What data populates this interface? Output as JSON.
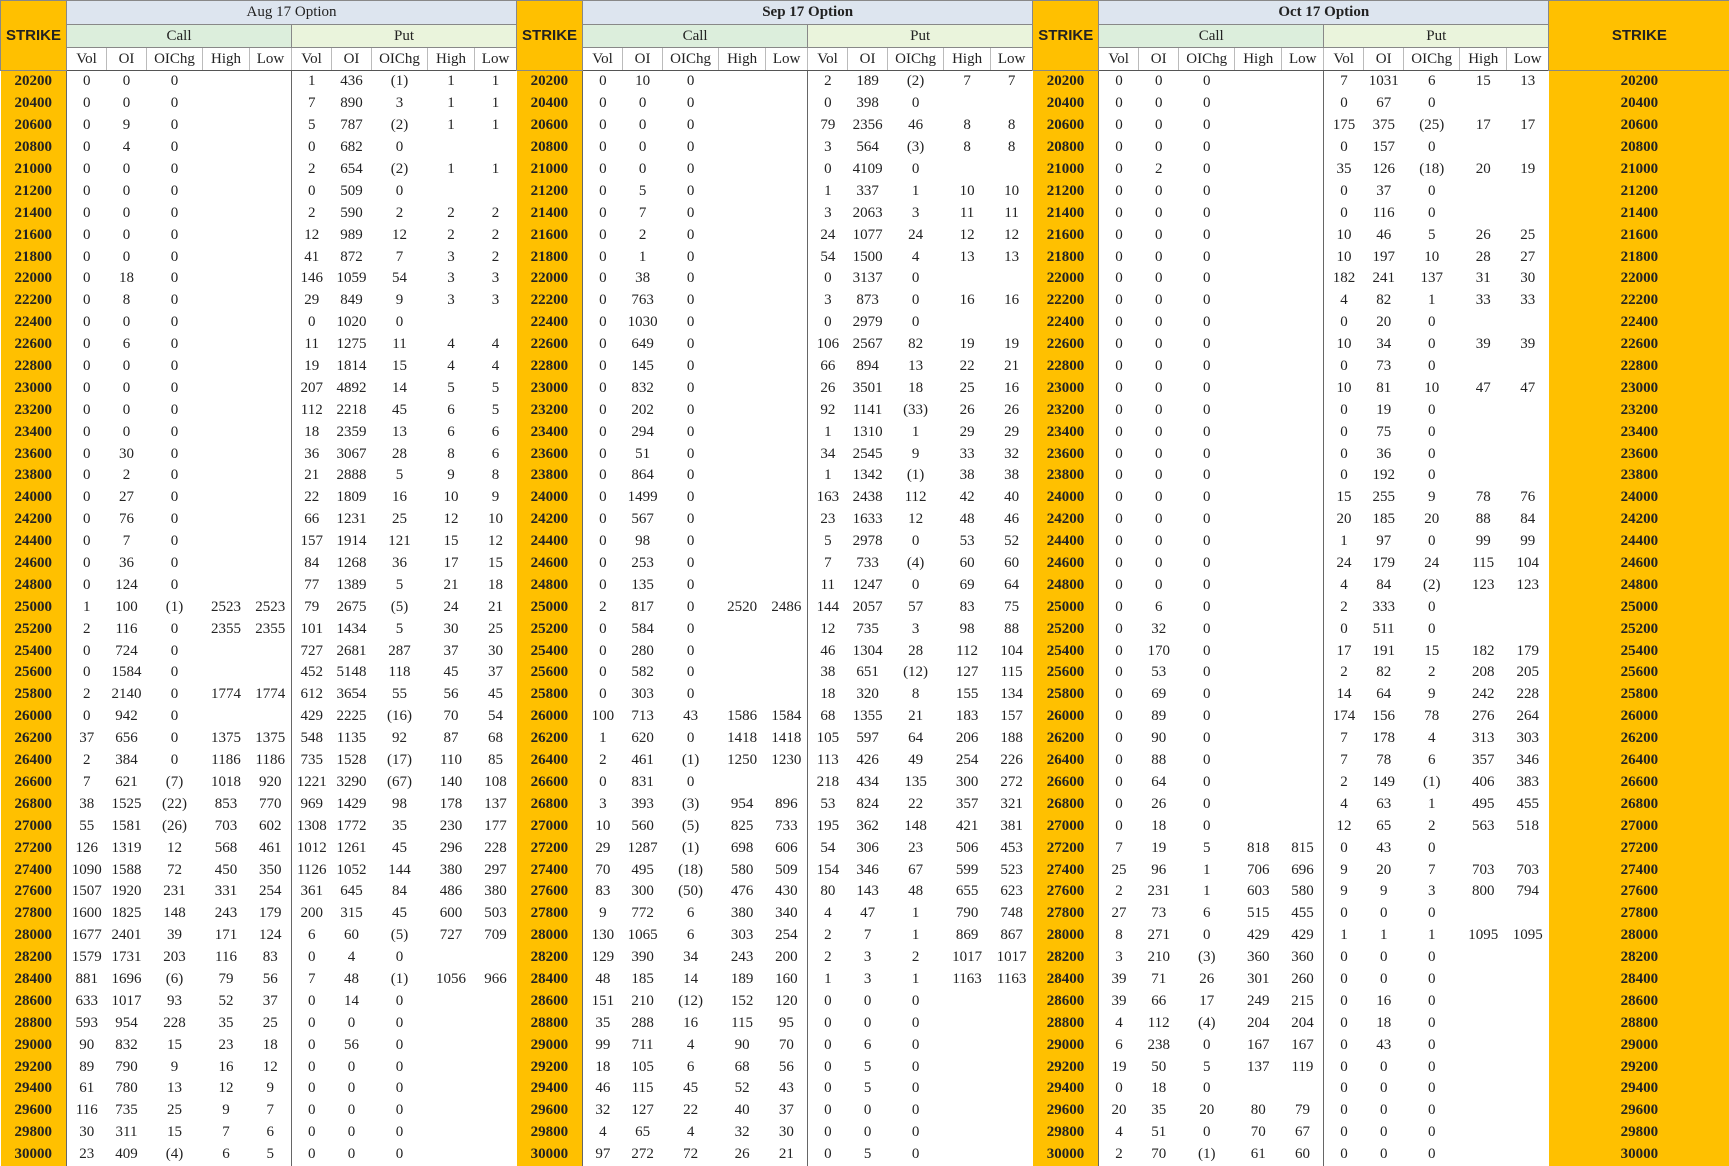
{
  "strike_label": "STRIKE",
  "columns": [
    "Vol",
    "OI",
    "OIChg",
    "High",
    "Low"
  ],
  "call_label": "Call",
  "put_label": "Put",
  "months": [
    "Aug 17 Option",
    "Sep 17 Option",
    "Oct 17 Option"
  ],
  "rows": [
    [
      "20200",
      "0",
      "0",
      "0",
      "",
      "",
      "1",
      "436",
      "(1)",
      "1",
      "1",
      "0",
      "10",
      "0",
      "",
      "",
      "2",
      "189",
      "(2)",
      "7",
      "7",
      "0",
      "0",
      "0",
      "",
      "",
      "7",
      "1031",
      "6",
      "15",
      "13"
    ],
    [
      "20400",
      "0",
      "0",
      "0",
      "",
      "",
      "7",
      "890",
      "3",
      "1",
      "1",
      "0",
      "0",
      "0",
      "",
      "",
      "0",
      "398",
      "0",
      "",
      "",
      "0",
      "0",
      "0",
      "",
      "",
      "0",
      "67",
      "0",
      "",
      ""
    ],
    [
      "20600",
      "0",
      "9",
      "0",
      "",
      "",
      "5",
      "787",
      "(2)",
      "1",
      "1",
      "0",
      "0",
      "0",
      "",
      "",
      "79",
      "2356",
      "46",
      "8",
      "8",
      "0",
      "0",
      "0",
      "",
      "",
      "175",
      "375",
      "(25)",
      "17",
      "17"
    ],
    [
      "20800",
      "0",
      "4",
      "0",
      "",
      "",
      "0",
      "682",
      "0",
      "",
      "",
      "0",
      "0",
      "0",
      "",
      "",
      "3",
      "564",
      "(3)",
      "8",
      "8",
      "0",
      "0",
      "0",
      "",
      "",
      "0",
      "157",
      "0",
      "",
      ""
    ],
    [
      "21000",
      "0",
      "0",
      "0",
      "",
      "",
      "2",
      "654",
      "(2)",
      "1",
      "1",
      "0",
      "0",
      "0",
      "",
      "",
      "0",
      "4109",
      "0",
      "",
      "",
      "0",
      "2",
      "0",
      "",
      "",
      "35",
      "126",
      "(18)",
      "20",
      "19"
    ],
    [
      "21200",
      "0",
      "0",
      "0",
      "",
      "",
      "0",
      "509",
      "0",
      "",
      "",
      "0",
      "5",
      "0",
      "",
      "",
      "1",
      "337",
      "1",
      "10",
      "10",
      "0",
      "0",
      "0",
      "",
      "",
      "0",
      "37",
      "0",
      "",
      ""
    ],
    [
      "21400",
      "0",
      "0",
      "0",
      "",
      "",
      "2",
      "590",
      "2",
      "2",
      "2",
      "0",
      "7",
      "0",
      "",
      "",
      "3",
      "2063",
      "3",
      "11",
      "11",
      "0",
      "0",
      "0",
      "",
      "",
      "0",
      "116",
      "0",
      "",
      ""
    ],
    [
      "21600",
      "0",
      "0",
      "0",
      "",
      "",
      "12",
      "989",
      "12",
      "2",
      "2",
      "0",
      "2",
      "0",
      "",
      "",
      "24",
      "1077",
      "24",
      "12",
      "12",
      "0",
      "0",
      "0",
      "",
      "",
      "10",
      "46",
      "5",
      "26",
      "25"
    ],
    [
      "21800",
      "0",
      "0",
      "0",
      "",
      "",
      "41",
      "872",
      "7",
      "3",
      "2",
      "0",
      "1",
      "0",
      "",
      "",
      "54",
      "1500",
      "4",
      "13",
      "13",
      "0",
      "0",
      "0",
      "",
      "",
      "10",
      "197",
      "10",
      "28",
      "27"
    ],
    [
      "22000",
      "0",
      "18",
      "0",
      "",
      "",
      "146",
      "1059",
      "54",
      "3",
      "3",
      "0",
      "38",
      "0",
      "",
      "",
      "0",
      "3137",
      "0",
      "",
      "",
      "0",
      "0",
      "0",
      "",
      "",
      "182",
      "241",
      "137",
      "31",
      "30"
    ],
    [
      "22200",
      "0",
      "8",
      "0",
      "",
      "",
      "29",
      "849",
      "9",
      "3",
      "3",
      "0",
      "763",
      "0",
      "",
      "",
      "3",
      "873",
      "0",
      "16",
      "16",
      "0",
      "0",
      "0",
      "",
      "",
      "4",
      "82",
      "1",
      "33",
      "33"
    ],
    [
      "22400",
      "0",
      "0",
      "0",
      "",
      "",
      "0",
      "1020",
      "0",
      "",
      "",
      "0",
      "1030",
      "0",
      "",
      "",
      "0",
      "2979",
      "0",
      "",
      "",
      "0",
      "0",
      "0",
      "",
      "",
      "0",
      "20",
      "0",
      "",
      ""
    ],
    [
      "22600",
      "0",
      "6",
      "0",
      "",
      "",
      "11",
      "1275",
      "11",
      "4",
      "4",
      "0",
      "649",
      "0",
      "",
      "",
      "106",
      "2567",
      "82",
      "19",
      "19",
      "0",
      "0",
      "0",
      "",
      "",
      "10",
      "34",
      "0",
      "39",
      "39"
    ],
    [
      "22800",
      "0",
      "0",
      "0",
      "",
      "",
      "19",
      "1814",
      "15",
      "4",
      "4",
      "0",
      "145",
      "0",
      "",
      "",
      "66",
      "894",
      "13",
      "22",
      "21",
      "0",
      "0",
      "0",
      "",
      "",
      "0",
      "73",
      "0",
      "",
      ""
    ],
    [
      "23000",
      "0",
      "0",
      "0",
      "",
      "",
      "207",
      "4892",
      "14",
      "5",
      "5",
      "0",
      "832",
      "0",
      "",
      "",
      "26",
      "3501",
      "18",
      "25",
      "16",
      "0",
      "0",
      "0",
      "",
      "",
      "10",
      "81",
      "10",
      "47",
      "47"
    ],
    [
      "23200",
      "0",
      "0",
      "0",
      "",
      "",
      "112",
      "2218",
      "45",
      "6",
      "5",
      "0",
      "202",
      "0",
      "",
      "",
      "92",
      "1141",
      "(33)",
      "26",
      "26",
      "0",
      "0",
      "0",
      "",
      "",
      "0",
      "19",
      "0",
      "",
      ""
    ],
    [
      "23400",
      "0",
      "0",
      "0",
      "",
      "",
      "18",
      "2359",
      "13",
      "6",
      "6",
      "0",
      "294",
      "0",
      "",
      "",
      "1",
      "1310",
      "1",
      "29",
      "29",
      "0",
      "0",
      "0",
      "",
      "",
      "0",
      "75",
      "0",
      "",
      ""
    ],
    [
      "23600",
      "0",
      "30",
      "0",
      "",
      "",
      "36",
      "3067",
      "28",
      "8",
      "6",
      "0",
      "51",
      "0",
      "",
      "",
      "34",
      "2545",
      "9",
      "33",
      "32",
      "0",
      "0",
      "0",
      "",
      "",
      "0",
      "36",
      "0",
      "",
      ""
    ],
    [
      "23800",
      "0",
      "2",
      "0",
      "",
      "",
      "21",
      "2888",
      "5",
      "9",
      "8",
      "0",
      "864",
      "0",
      "",
      "",
      "1",
      "1342",
      "(1)",
      "38",
      "38",
      "0",
      "0",
      "0",
      "",
      "",
      "0",
      "192",
      "0",
      "",
      ""
    ],
    [
      "24000",
      "0",
      "27",
      "0",
      "",
      "",
      "22",
      "1809",
      "16",
      "10",
      "9",
      "0",
      "1499",
      "0",
      "",
      "",
      "163",
      "2438",
      "112",
      "42",
      "40",
      "0",
      "0",
      "0",
      "",
      "",
      "15",
      "255",
      "9",
      "78",
      "76"
    ],
    [
      "24200",
      "0",
      "76",
      "0",
      "",
      "",
      "66",
      "1231",
      "25",
      "12",
      "10",
      "0",
      "567",
      "0",
      "",
      "",
      "23",
      "1633",
      "12",
      "48",
      "46",
      "0",
      "0",
      "0",
      "",
      "",
      "20",
      "185",
      "20",
      "88",
      "84"
    ],
    [
      "24400",
      "0",
      "7",
      "0",
      "",
      "",
      "157",
      "1914",
      "121",
      "15",
      "12",
      "0",
      "98",
      "0",
      "",
      "",
      "5",
      "2978",
      "0",
      "53",
      "52",
      "0",
      "0",
      "0",
      "",
      "",
      "1",
      "97",
      "0",
      "99",
      "99"
    ],
    [
      "24600",
      "0",
      "36",
      "0",
      "",
      "",
      "84",
      "1268",
      "36",
      "17",
      "15",
      "0",
      "253",
      "0",
      "",
      "",
      "7",
      "733",
      "(4)",
      "60",
      "60",
      "0",
      "0",
      "0",
      "",
      "",
      "24",
      "179",
      "24",
      "115",
      "104"
    ],
    [
      "24800",
      "0",
      "124",
      "0",
      "",
      "",
      "77",
      "1389",
      "5",
      "21",
      "18",
      "0",
      "135",
      "0",
      "",
      "",
      "11",
      "1247",
      "0",
      "69",
      "64",
      "0",
      "0",
      "0",
      "",
      "",
      "4",
      "84",
      "(2)",
      "123",
      "123"
    ],
    [
      "25000",
      "1",
      "100",
      "(1)",
      "2523",
      "2523",
      "79",
      "2675",
      "(5)",
      "24",
      "21",
      "2",
      "817",
      "0",
      "2520",
      "2486",
      "144",
      "2057",
      "57",
      "83",
      "75",
      "0",
      "6",
      "0",
      "",
      "",
      "2",
      "333",
      "0",
      "",
      ""
    ],
    [
      "25200",
      "2",
      "116",
      "0",
      "2355",
      "2355",
      "101",
      "1434",
      "5",
      "30",
      "25",
      "0",
      "584",
      "0",
      "",
      "",
      "12",
      "735",
      "3",
      "98",
      "88",
      "0",
      "32",
      "0",
      "",
      "",
      "0",
      "511",
      "0",
      "",
      ""
    ],
    [
      "25400",
      "0",
      "724",
      "0",
      "",
      "",
      "727",
      "2681",
      "287",
      "37",
      "30",
      "0",
      "280",
      "0",
      "",
      "",
      "46",
      "1304",
      "28",
      "112",
      "104",
      "0",
      "170",
      "0",
      "",
      "",
      "17",
      "191",
      "15",
      "182",
      "179"
    ],
    [
      "25600",
      "0",
      "1584",
      "0",
      "",
      "",
      "452",
      "5148",
      "118",
      "45",
      "37",
      "0",
      "582",
      "0",
      "",
      "",
      "38",
      "651",
      "(12)",
      "127",
      "115",
      "0",
      "53",
      "0",
      "",
      "",
      "2",
      "82",
      "2",
      "208",
      "205"
    ],
    [
      "25800",
      "2",
      "2140",
      "0",
      "1774",
      "1774",
      "612",
      "3654",
      "55",
      "56",
      "45",
      "0",
      "303",
      "0",
      "",
      "",
      "18",
      "320",
      "8",
      "155",
      "134",
      "0",
      "69",
      "0",
      "",
      "",
      "14",
      "64",
      "9",
      "242",
      "228"
    ],
    [
      "26000",
      "0",
      "942",
      "0",
      "",
      "",
      "429",
      "2225",
      "(16)",
      "70",
      "54",
      "100",
      "713",
      "43",
      "1586",
      "1584",
      "68",
      "1355",
      "21",
      "183",
      "157",
      "0",
      "89",
      "0",
      "",
      "",
      "174",
      "156",
      "78",
      "276",
      "264"
    ],
    [
      "26200",
      "37",
      "656",
      "0",
      "1375",
      "1375",
      "548",
      "1135",
      "92",
      "87",
      "68",
      "1",
      "620",
      "0",
      "1418",
      "1418",
      "105",
      "597",
      "64",
      "206",
      "188",
      "0",
      "90",
      "0",
      "",
      "",
      "7",
      "178",
      "4",
      "313",
      "303"
    ],
    [
      "26400",
      "2",
      "384",
      "0",
      "1186",
      "1186",
      "735",
      "1528",
      "(17)",
      "110",
      "85",
      "2",
      "461",
      "(1)",
      "1250",
      "1230",
      "113",
      "426",
      "49",
      "254",
      "226",
      "0",
      "88",
      "0",
      "",
      "",
      "7",
      "78",
      "6",
      "357",
      "346"
    ],
    [
      "26600",
      "7",
      "621",
      "(7)",
      "1018",
      "920",
      "1221",
      "3290",
      "(67)",
      "140",
      "108",
      "0",
      "831",
      "0",
      "",
      "",
      "218",
      "434",
      "135",
      "300",
      "272",
      "0",
      "64",
      "0",
      "",
      "",
      "2",
      "149",
      "(1)",
      "406",
      "383"
    ],
    [
      "26800",
      "38",
      "1525",
      "(22)",
      "853",
      "770",
      "969",
      "1429",
      "98",
      "178",
      "137",
      "3",
      "393",
      "(3)",
      "954",
      "896",
      "53",
      "824",
      "22",
      "357",
      "321",
      "0",
      "26",
      "0",
      "",
      "",
      "4",
      "63",
      "1",
      "495",
      "455"
    ],
    [
      "27000",
      "55",
      "1581",
      "(26)",
      "703",
      "602",
      "1308",
      "1772",
      "35",
      "230",
      "177",
      "10",
      "560",
      "(5)",
      "825",
      "733",
      "195",
      "362",
      "148",
      "421",
      "381",
      "0",
      "18",
      "0",
      "",
      "",
      "12",
      "65",
      "2",
      "563",
      "518"
    ],
    [
      "27200",
      "126",
      "1319",
      "12",
      "568",
      "461",
      "1012",
      "1261",
      "45",
      "296",
      "228",
      "29",
      "1287",
      "(1)",
      "698",
      "606",
      "54",
      "306",
      "23",
      "506",
      "453",
      "7",
      "19",
      "5",
      "818",
      "815",
      "0",
      "43",
      "0",
      "",
      ""
    ],
    [
      "27400",
      "1090",
      "1588",
      "72",
      "450",
      "350",
      "1126",
      "1052",
      "144",
      "380",
      "297",
      "70",
      "495",
      "(18)",
      "580",
      "509",
      "154",
      "346",
      "67",
      "599",
      "523",
      "25",
      "96",
      "1",
      "706",
      "696",
      "9",
      "20",
      "7",
      "703",
      "703"
    ],
    [
      "27600",
      "1507",
      "1920",
      "231",
      "331",
      "254",
      "361",
      "645",
      "84",
      "486",
      "380",
      "83",
      "300",
      "(50)",
      "476",
      "430",
      "80",
      "143",
      "48",
      "655",
      "623",
      "2",
      "231",
      "1",
      "603",
      "580",
      "9",
      "9",
      "3",
      "800",
      "794"
    ],
    [
      "27800",
      "1600",
      "1825",
      "148",
      "243",
      "179",
      "200",
      "315",
      "45",
      "600",
      "503",
      "9",
      "772",
      "6",
      "380",
      "340",
      "4",
      "47",
      "1",
      "790",
      "748",
      "27",
      "73",
      "6",
      "515",
      "455",
      "0",
      "0",
      "0",
      "",
      ""
    ],
    [
      "28000",
      "1677",
      "2401",
      "39",
      "171",
      "124",
      "6",
      "60",
      "(5)",
      "727",
      "709",
      "130",
      "1065",
      "6",
      "303",
      "254",
      "2",
      "7",
      "1",
      "869",
      "867",
      "8",
      "271",
      "0",
      "429",
      "429",
      "1",
      "1",
      "1",
      "1095",
      "1095"
    ],
    [
      "28200",
      "1579",
      "1731",
      "203",
      "116",
      "83",
      "0",
      "4",
      "0",
      "",
      "",
      "129",
      "390",
      "34",
      "243",
      "200",
      "2",
      "3",
      "2",
      "1017",
      "1017",
      "3",
      "210",
      "(3)",
      "360",
      "360",
      "0",
      "0",
      "0",
      "",
      ""
    ],
    [
      "28400",
      "881",
      "1696",
      "(6)",
      "79",
      "56",
      "7",
      "48",
      "(1)",
      "1056",
      "966",
      "48",
      "185",
      "14",
      "189",
      "160",
      "1",
      "3",
      "1",
      "1163",
      "1163",
      "39",
      "71",
      "26",
      "301",
      "260",
      "0",
      "0",
      "0",
      "",
      ""
    ],
    [
      "28600",
      "633",
      "1017",
      "93",
      "52",
      "37",
      "0",
      "14",
      "0",
      "",
      "",
      "151",
      "210",
      "(12)",
      "152",
      "120",
      "0",
      "0",
      "0",
      "",
      "",
      "39",
      "66",
      "17",
      "249",
      "215",
      "0",
      "16",
      "0",
      "",
      ""
    ],
    [
      "28800",
      "593",
      "954",
      "228",
      "35",
      "25",
      "0",
      "0",
      "0",
      "",
      "",
      "35",
      "288",
      "16",
      "115",
      "95",
      "0",
      "0",
      "0",
      "",
      "",
      "4",
      "112",
      "(4)",
      "204",
      "204",
      "0",
      "18",
      "0",
      "",
      ""
    ],
    [
      "29000",
      "90",
      "832",
      "15",
      "23",
      "18",
      "0",
      "56",
      "0",
      "",
      "",
      "99",
      "711",
      "4",
      "90",
      "70",
      "0",
      "6",
      "0",
      "",
      "",
      "6",
      "238",
      "0",
      "167",
      "167",
      "0",
      "43",
      "0",
      "",
      ""
    ],
    [
      "29200",
      "89",
      "790",
      "9",
      "16",
      "12",
      "0",
      "0",
      "0",
      "",
      "",
      "18",
      "105",
      "6",
      "68",
      "56",
      "0",
      "5",
      "0",
      "",
      "",
      "19",
      "50",
      "5",
      "137",
      "119",
      "0",
      "0",
      "0",
      "",
      ""
    ],
    [
      "29400",
      "61",
      "780",
      "13",
      "12",
      "9",
      "0",
      "0",
      "0",
      "",
      "",
      "46",
      "115",
      "45",
      "52",
      "43",
      "0",
      "5",
      "0",
      "",
      "",
      "0",
      "18",
      "0",
      "",
      "",
      "0",
      "0",
      "0",
      "",
      ""
    ],
    [
      "29600",
      "116",
      "735",
      "25",
      "9",
      "7",
      "0",
      "0",
      "0",
      "",
      "",
      "32",
      "127",
      "22",
      "40",
      "37",
      "0",
      "0",
      "0",
      "",
      "",
      "20",
      "35",
      "20",
      "80",
      "79",
      "0",
      "0",
      "0",
      "",
      ""
    ],
    [
      "29800",
      "30",
      "311",
      "15",
      "7",
      "6",
      "0",
      "0",
      "0",
      "",
      "",
      "4",
      "65",
      "4",
      "32",
      "30",
      "0",
      "0",
      "0",
      "",
      "",
      "4",
      "51",
      "0",
      "70",
      "67",
      "0",
      "0",
      "0",
      "",
      ""
    ],
    [
      "30000",
      "23",
      "409",
      "(4)",
      "6",
      "5",
      "0",
      "0",
      "0",
      "",
      "",
      "97",
      "272",
      "72",
      "26",
      "21",
      "0",
      "5",
      "0",
      "",
      "",
      "2",
      "70",
      "(1)",
      "61",
      "60",
      "0",
      "0",
      "0",
      "",
      ""
    ]
  ]
}
